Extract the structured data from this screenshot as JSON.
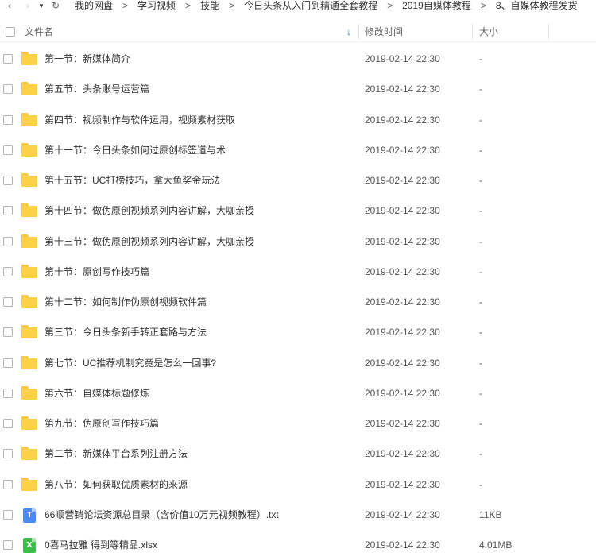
{
  "nav": {
    "back_icon": "‹",
    "forward_icon": "›",
    "dropdown_icon": "▼",
    "refresh_icon": "↻",
    "breadcrumbs": [
      "我的网盘",
      "学习视频",
      "技能",
      "今日头条从入门到精通全套教程",
      "2019自媒体教程",
      "8、自媒体教程发货"
    ],
    "separator": ">"
  },
  "header": {
    "name": "文件名",
    "sort_icon": "↓",
    "date": "修改时间",
    "size": "大小"
  },
  "files": [
    {
      "name": "第一节：新媒体简介",
      "date": "2019-02-14 22:30",
      "size": "-",
      "type": "folder"
    },
    {
      "name": "第五节：头条账号运营篇",
      "date": "2019-02-14 22:30",
      "size": "-",
      "type": "folder"
    },
    {
      "name": "第四节：视频制作与软件运用，视频素材获取",
      "date": "2019-02-14 22:30",
      "size": "-",
      "type": "folder"
    },
    {
      "name": "第十一节：今日头条如何过原创标签道与术",
      "date": "2019-02-14 22:30",
      "size": "-",
      "type": "folder"
    },
    {
      "name": "第十五节：UC打榜技巧，拿大鱼奖金玩法",
      "date": "2019-02-14 22:30",
      "size": "-",
      "type": "folder"
    },
    {
      "name": "第十四节：做伪原创视频系列内容讲解，大咖亲授",
      "date": "2019-02-14 22:30",
      "size": "-",
      "type": "folder"
    },
    {
      "name": "第十三节：做伪原创视频系列内容讲解，大咖亲授",
      "date": "2019-02-14 22:30",
      "size": "-",
      "type": "folder"
    },
    {
      "name": "第十节：原创写作技巧篇",
      "date": "2019-02-14 22:30",
      "size": "-",
      "type": "folder"
    },
    {
      "name": "第十二节：如何制作伪原创视频软件篇",
      "date": "2019-02-14 22:30",
      "size": "-",
      "type": "folder"
    },
    {
      "name": "第三节：今日头条新手转正套路与方法",
      "date": "2019-02-14 22:30",
      "size": "-",
      "type": "folder"
    },
    {
      "name": "第七节：UC推荐机制究竟是怎么一回事?",
      "date": "2019-02-14 22:30",
      "size": "-",
      "type": "folder"
    },
    {
      "name": "第六节：自媒体标题修炼",
      "date": "2019-02-14 22:30",
      "size": "-",
      "type": "folder"
    },
    {
      "name": "第九节：伪原创写作技巧篇",
      "date": "2019-02-14 22:30",
      "size": "-",
      "type": "folder"
    },
    {
      "name": "第二节：新媒体平台系列注册方法",
      "date": "2019-02-14 22:30",
      "size": "-",
      "type": "folder"
    },
    {
      "name": "第八节：如何获取优质素材的来源",
      "date": "2019-02-14 22:30",
      "size": "-",
      "type": "folder"
    },
    {
      "name": "66顺营销论坛资源总目录（含价值10万元视频教程）.txt",
      "date": "2019-02-14 22:30",
      "size": "11KB",
      "type": "txt",
      "glyph": "T"
    },
    {
      "name": "0喜马拉雅 得到等精品.xlsx",
      "date": "2019-02-14 22:30",
      "size": "4.01MB",
      "type": "xlsx",
      "glyph": "X"
    }
  ]
}
